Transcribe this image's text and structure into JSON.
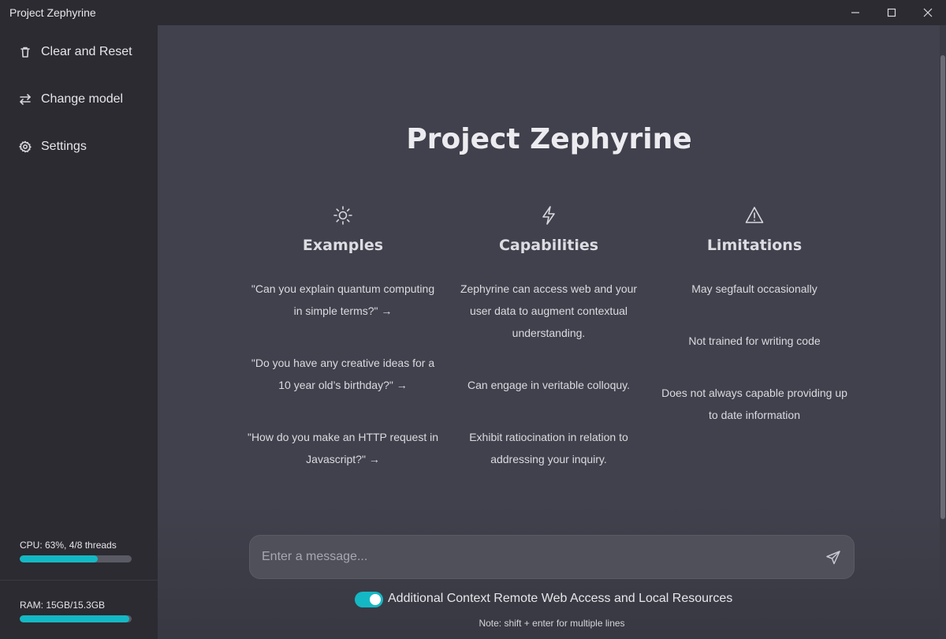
{
  "window": {
    "title": "Project Zephyrine",
    "controls": [
      "minimize",
      "maximize",
      "close"
    ]
  },
  "sidebar": {
    "items": [
      {
        "label": "Clear and Reset",
        "icon": "trash-icon"
      },
      {
        "label": "Change model",
        "icon": "swap-arrows-icon"
      },
      {
        "label": "Settings",
        "icon": "gear-icon"
      }
    ],
    "cpu": {
      "text": "CPU: 63%, 4/8 threads",
      "usage": 0.7
    },
    "ram": {
      "text": "RAM: 15GB/15.3GB",
      "usage": 0.98
    }
  },
  "main": {
    "heading": "Project Zephyrine",
    "columns": [
      {
        "title": "Examples",
        "icon": "sun-icon",
        "items": [
          "\"Can you explain quantum computing in simple terms?\" →",
          "\"Do you have any creative ideas for a 10 year old’s birthday?\" →",
          "\"How do you make an HTTP request in Javascript?\" →"
        ]
      },
      {
        "title": "Capabilities",
        "icon": "lightning-icon",
        "items": [
          "Zephyrine can access web and your user data to augment contextual understanding.",
          "Can engage in veritable colloquy.",
          "Exhibit ratiocination in relation to addressing your inquiry."
        ]
      },
      {
        "title": "Limitations",
        "icon": "warning-triangle-icon",
        "items": [
          "May segfault occasionally",
          "Not trained for writing code",
          "Does not always capable providing up to date information"
        ]
      }
    ],
    "input": {
      "placeholder": "Enter a message...",
      "value": ""
    },
    "toggle": {
      "label": "Additional Context Remote Web Access and Local Resources",
      "on": true
    },
    "note": "Note: shift + enter for multiple lines"
  },
  "colors": {
    "accent": "#14b8c4",
    "sidebar_bg": "#2b2b31",
    "main_bg": "#41414d"
  }
}
